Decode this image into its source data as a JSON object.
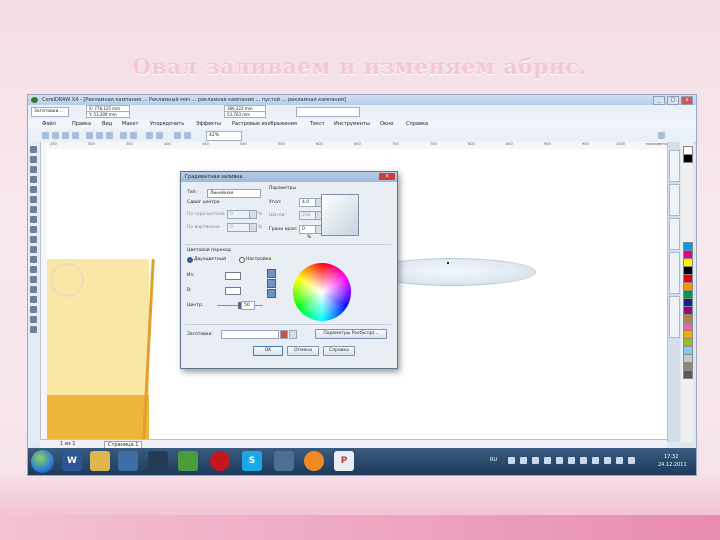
{
  "slide": {
    "title": "Овал заливаем и изменяем абрис."
  },
  "app": {
    "title": "CorelDRAW X4 - [Рекламная кампания ... Рекламный мяч ... рекламная кампания ... пустой ... рекламная кампания]",
    "preset": "Заготовки...",
    "coord_x": "X: 778,125 mm",
    "coord_y": "Y: 53,309 mm",
    "size_w": "386,322 mm",
    "size_h": "53,703 mm",
    "zoom": "42%",
    "win_minimize": "_",
    "win_maximize": "□",
    "win_close": "x"
  },
  "menu": [
    "Файл",
    "Правка",
    "Вид",
    "Макет",
    "Упорядочить",
    "Эффекты",
    "Растровые изображения",
    "Текст",
    "Инструменты",
    "Окно",
    "Справка"
  ],
  "ruler_ticks": [
    "250",
    "300",
    "350",
    "400",
    "450",
    "500",
    "550",
    "600",
    "650",
    "700",
    "750",
    "800",
    "850",
    "900",
    "950",
    "1000",
    "миллиметры"
  ],
  "dialog": {
    "title": "Градиентная заливка",
    "close": "x",
    "type_label": "Тип:",
    "type_value": "Линейная",
    "center_label": "Сдвиг центра",
    "horiz_label": "По горизонтали",
    "horiz_value": "0",
    "vert_label": "По вертикали",
    "vert_value": "0",
    "params_label": "Параметры",
    "angle_label": "Угол:",
    "angle_value": "4,0",
    "steps_label": "Шагов:",
    "steps_value": "256",
    "edge_label": "Грани края:",
    "edge_value": "0",
    "percent": "%",
    "blend_label": "Цветовой переход",
    "two_color": "Двухцветный",
    "custom": "Настройка",
    "from_label": "Из:",
    "to_label": "В:",
    "mid_label": "Центр:",
    "mid_value": "50",
    "presets_label": "Заготовки:",
    "postscript": "Параметры PostScript...",
    "ok": "OK",
    "cancel": "Отмена",
    "help": "Справка"
  },
  "status": {
    "pages": "1 из 1",
    "page_tab": "Страница 1"
  },
  "tray": {
    "lang": "RU",
    "time": "17:32",
    "date": "24.12.2011"
  },
  "taskbar_icons": [
    "word-icon",
    "explorer-icon",
    "media-icon",
    "chess-icon",
    "corel-icon",
    "opera-icon",
    "skype-icon",
    "app-icon",
    "ball-icon",
    "paint-icon"
  ],
  "colors": {
    "accent": "#2b62a8",
    "slide_title": "#f5c6d4",
    "page_yellow": "#fbe7a5",
    "page_orange": "#f0b63c"
  }
}
